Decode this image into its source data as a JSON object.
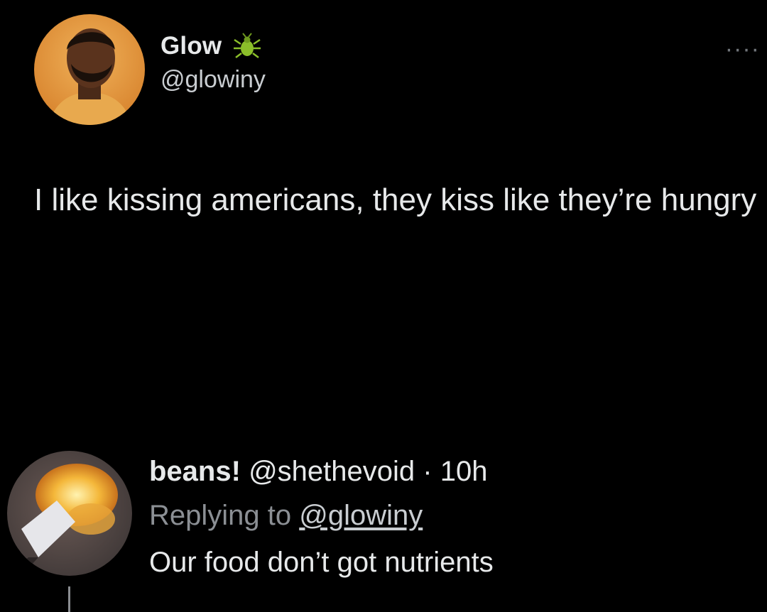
{
  "tweet": {
    "author": {
      "display_name": "Glow",
      "handle": "@glowiny",
      "badge_icon": "bug-icon",
      "avatar_icon": "avatar"
    },
    "more_icon": "more-icon",
    "more_label": "····",
    "text": "I like kissing americans, they kiss like they’re hungry"
  },
  "reply": {
    "author": {
      "display_name": "beans!",
      "handle": "@shethevoid",
      "avatar_icon": "avatar"
    },
    "separator": "·",
    "time": "10h",
    "replying_prefix": "Replying to",
    "replying_handle": "@glowiny",
    "text": "Our food don’t got nutrients"
  },
  "colors": {
    "background": "#000000",
    "text_primary": "#e7e9ea",
    "text_secondary": "#8b8f94",
    "bug_badge": "#8bbf2a"
  }
}
